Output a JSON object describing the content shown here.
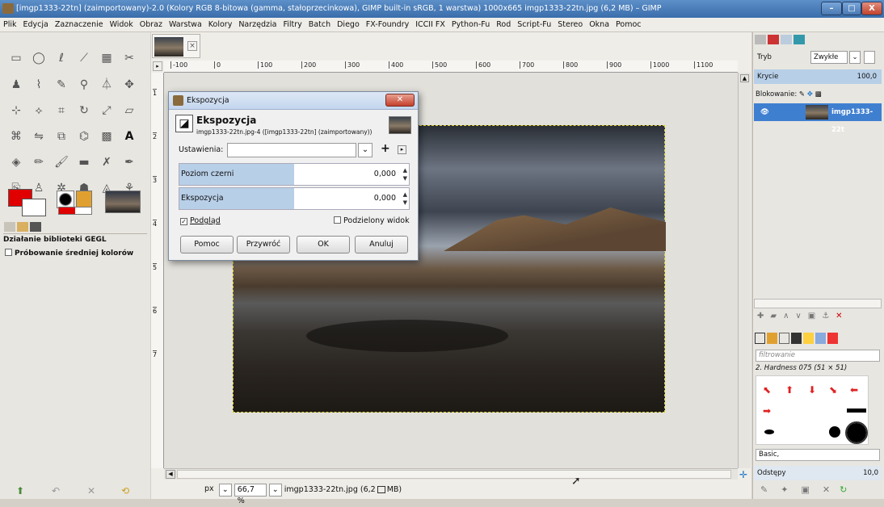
{
  "window": {
    "title": "[imgp1333-22tn] (zaimportowany)-2.0 (Kolory RGB 8-bitowa (gamma, stałoprzecinkowa), GIMP built-in sRGB, 1 warstwa) 1000x665 imgp1333-22tn.jpg (6,2 MB) – GIMP",
    "min": "–",
    "max": "□",
    "close": "X"
  },
  "menu": [
    "Plik",
    "Edycja",
    "Zaznaczenie",
    "Widok",
    "Obraz",
    "Warstwa",
    "Kolory",
    "Narzędzia",
    "Filtry",
    "Batch",
    "Diego",
    "FX-Foundry",
    "ICCII FX",
    "Python-Fu",
    "Rod",
    "Script-Fu",
    "Stereo",
    "Okna",
    "Pomoc"
  ],
  "toolbox": {
    "tool_options_1": "Działanie biblioteki GEGL",
    "tool_options_2": "Próbowanie średniej kolorów",
    "colors": {
      "foreground": "#e00000",
      "background": "#ffffff"
    }
  },
  "ruler": {
    "h_labels": [
      "-100",
      "0",
      "100",
      "200",
      "300",
      "400",
      "500",
      "600",
      "700",
      "800",
      "900",
      "1000",
      "1100"
    ],
    "v_labels": [
      "1",
      "2",
      "3",
      "4",
      "5",
      "6",
      "7"
    ]
  },
  "status": {
    "unit": "px",
    "zoom": "66,7 %",
    "file": "imgp1333-22tn.jpg (6,2",
    "file_suffix": "MB)"
  },
  "dock": {
    "mode_label": "Tryb",
    "mode_value": "Zwykłe",
    "opacity_label": "Krycie",
    "opacity_value": "100,0",
    "lock_label": "Blokowanie:",
    "layer_name": "imgp1333-22t",
    "brush_filter_placeholder": "filtrowanie",
    "brush_name": "2. Hardness 075 (51 × 51)",
    "preset": "Basic,",
    "spacing_label": "Odstępy",
    "spacing_value": "10,0"
  },
  "dialog": {
    "title": "Ekspozycja",
    "heading": "Ekspozycja",
    "subheading": "imgp1333-22tn.jpg-4 ([imgp1333-22tn] (zaimportowany))",
    "settings_label": "Ustawienia:",
    "settings_value": "",
    "field1_label": "Poziom czerni",
    "field1_value": "0,000",
    "field1_fill": 0.5,
    "field2_label": "Ekspozycja",
    "field2_value": "0,000",
    "field2_fill": 0.5,
    "preview_label": "Podgląd",
    "split_label": "Podzielony widok",
    "btn_help": "Pomoc",
    "btn_reset": "Przywróć",
    "btn_ok": "OK",
    "btn_cancel": "Anuluj"
  }
}
